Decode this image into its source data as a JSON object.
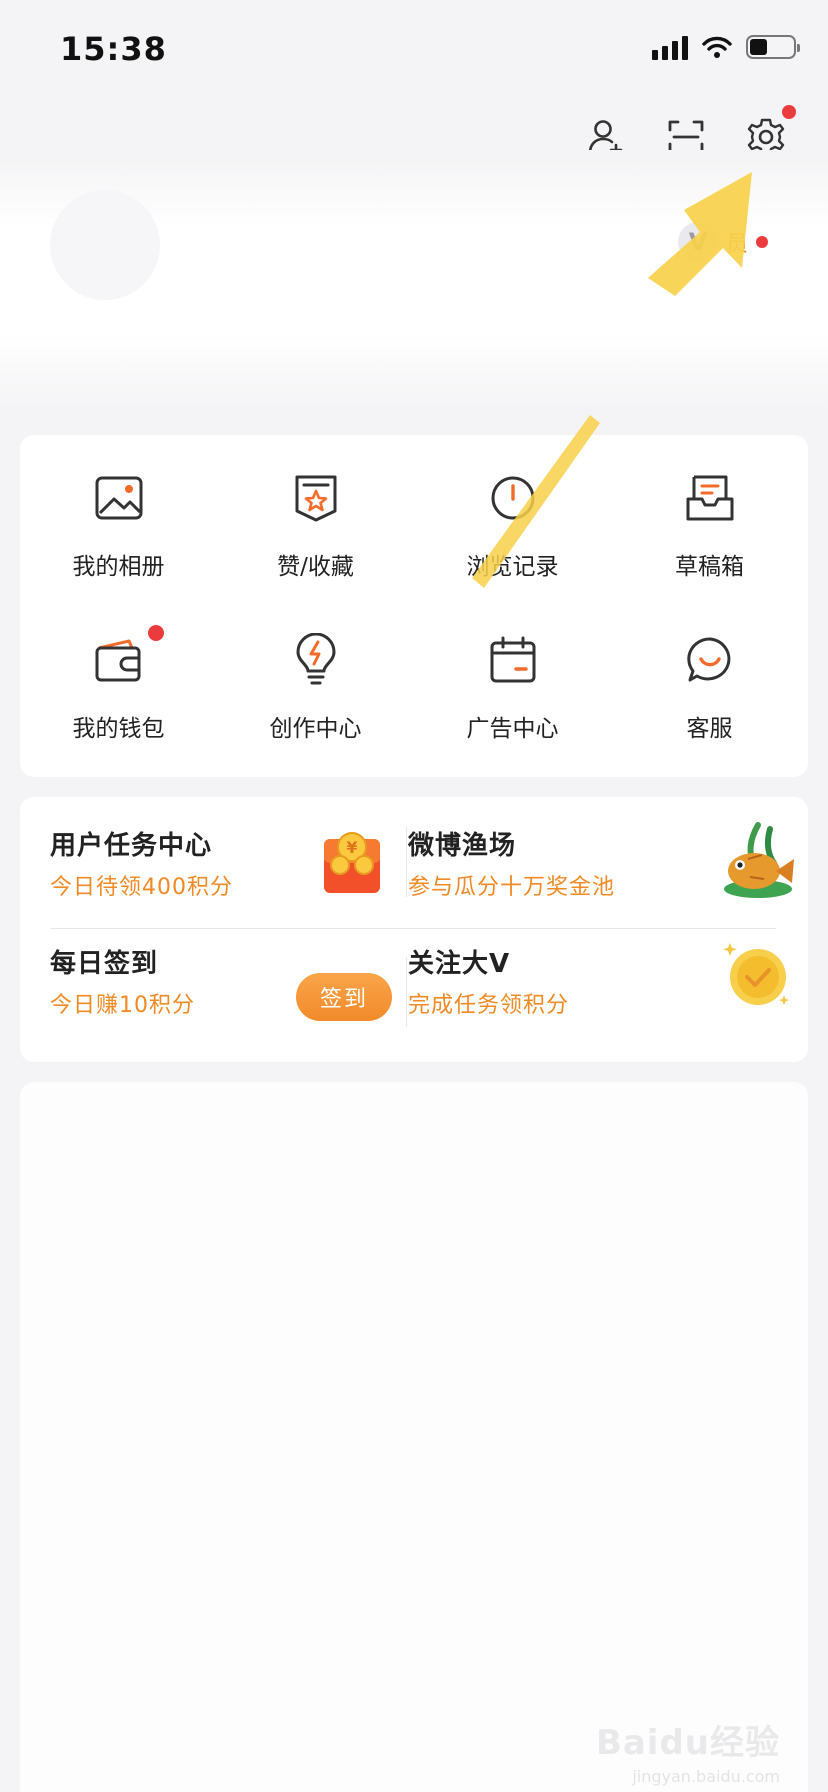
{
  "status_bar": {
    "time": "15:38"
  },
  "header": {
    "vip_label": "员"
  },
  "features": [
    {
      "label": "我的相册",
      "icon": "album-icon"
    },
    {
      "label": "赞/收藏",
      "icon": "favorite-icon"
    },
    {
      "label": "浏览记录",
      "icon": "history-icon"
    },
    {
      "label": "草稿箱",
      "icon": "drafts-icon"
    },
    {
      "label": "我的钱包",
      "icon": "wallet-icon"
    },
    {
      "label": "创作中心",
      "icon": "creator-icon"
    },
    {
      "label": "广告中心",
      "icon": "ad-center-icon"
    },
    {
      "label": "客服",
      "icon": "customer-service-icon"
    }
  ],
  "tasks": {
    "task_center": {
      "title": "用户任务中心",
      "subtitle": "今日待领400积分"
    },
    "fishery": {
      "title": "微博渔场",
      "subtitle": "参与瓜分十万奖金池"
    },
    "checkin": {
      "title": "每日签到",
      "subtitle": "今日赚10积分",
      "button": "签到"
    },
    "follow_v": {
      "title": "关注大V",
      "subtitle": "完成任务领积分"
    }
  },
  "watermark": {
    "brand": "Baidu经验",
    "url": "jingyan.baidu.com"
  },
  "colors": {
    "accent": "#f08a24",
    "badge": "#ea3c3c",
    "arrow": "#f7d04a"
  }
}
